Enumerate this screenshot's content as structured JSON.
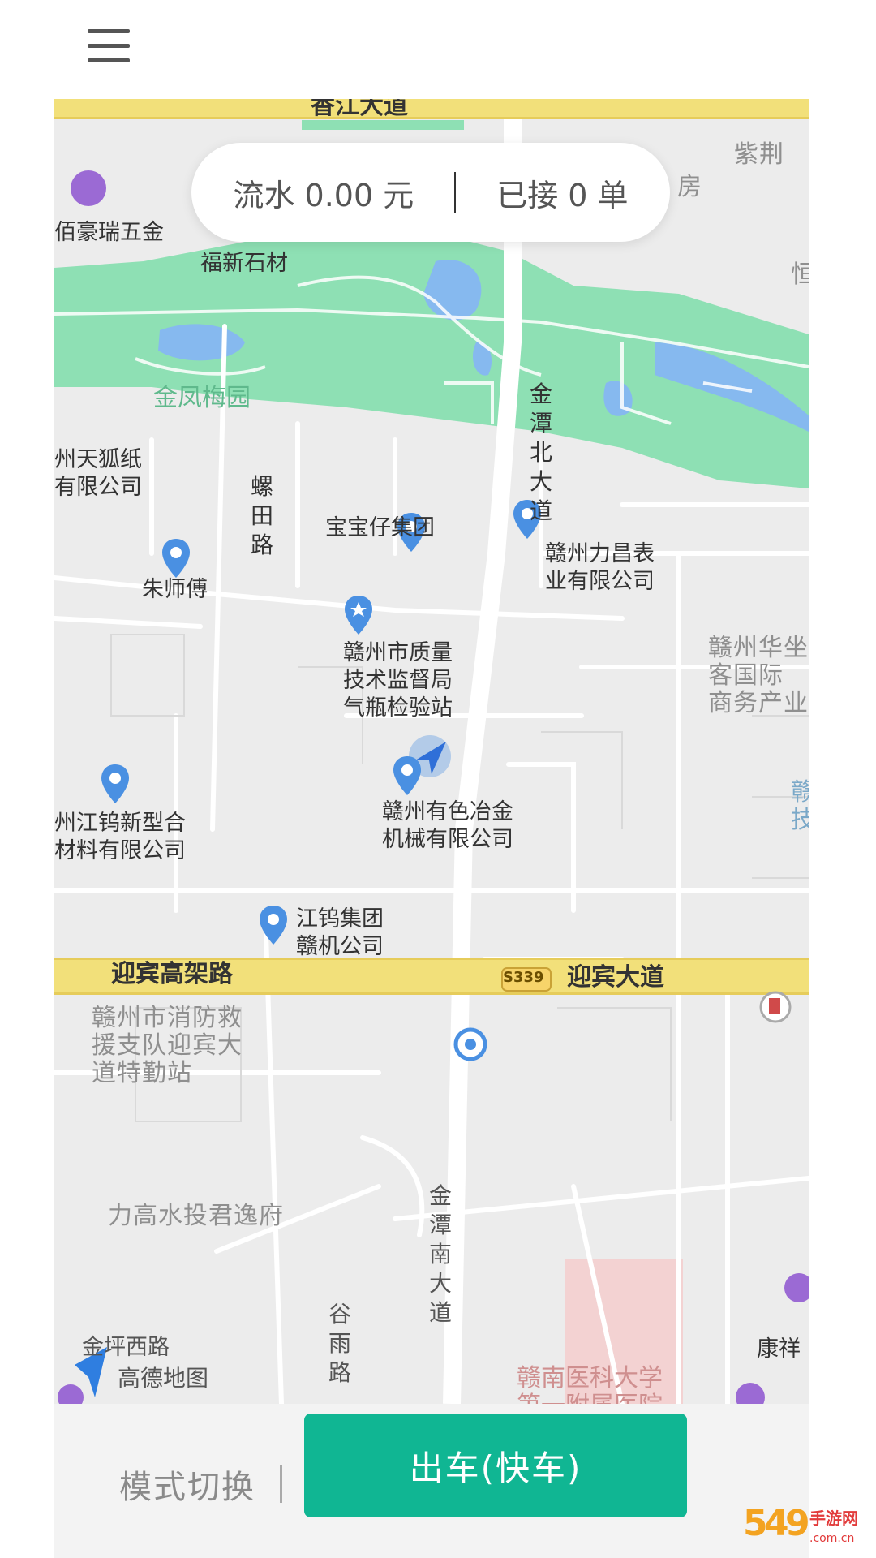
{
  "header": {
    "menu_icon": "hamburger-menu-icon"
  },
  "stats": {
    "revenue_label": "流水 0.00 元",
    "orders_label": "已接 0 单"
  },
  "map": {
    "poi": {
      "baihaorui": "佰豪瑞五金",
      "fuxin": "福新石材",
      "zijing": "紫荆",
      "fang": "房",
      "heng": "恒",
      "tianhu": "州天狐纸\n有限公司",
      "baobaozai": "宝宝仔集团",
      "lichang": "赣州力昌表\n业有限公司",
      "zhushifu": "朱师傅",
      "zhiliang": "赣州市质量\n技术监督局\n气瓶检验站",
      "huaye": "赣州华坐\n客国际\n商务产业",
      "jiangwu_new": "州江钨新型合\n材料有限公司",
      "youse": "赣州有色冶金\n机械有限公司",
      "jiangwu_group": "江钨集团\n赣机公司",
      "ganji": "赣\n技",
      "xiaofang": "赣州市消防救\n援支队迎宾大\n道特勤站",
      "lgao": "力高水投君逸府",
      "kangxiang": "康祥",
      "jinping": "金坪西路",
      "hospital": "赣南医科大学\n第一附属医院",
      "jinfeng": "金凤梅园"
    },
    "roads": {
      "xiangjiang": "香江大道",
      "luotian": "螺田路",
      "jintan_north": "金潭北大道",
      "yingbin_elevated": "迎宾高架路",
      "s339": "S339",
      "yingbin": "迎宾大道",
      "jintan_south": "金潭南大道",
      "guyu": "谷雨路"
    },
    "attribution": "高德地图"
  },
  "bottom": {
    "mode_switch": "模式切换",
    "start_button": "出车(快车)"
  },
  "watermark": {
    "text": "手游网"
  },
  "colors": {
    "accent": "#10b693",
    "park": "#8ee0b4",
    "water": "#86b9ef",
    "major_road": "#f2e07a",
    "poi_pin": "#4a90e2"
  }
}
